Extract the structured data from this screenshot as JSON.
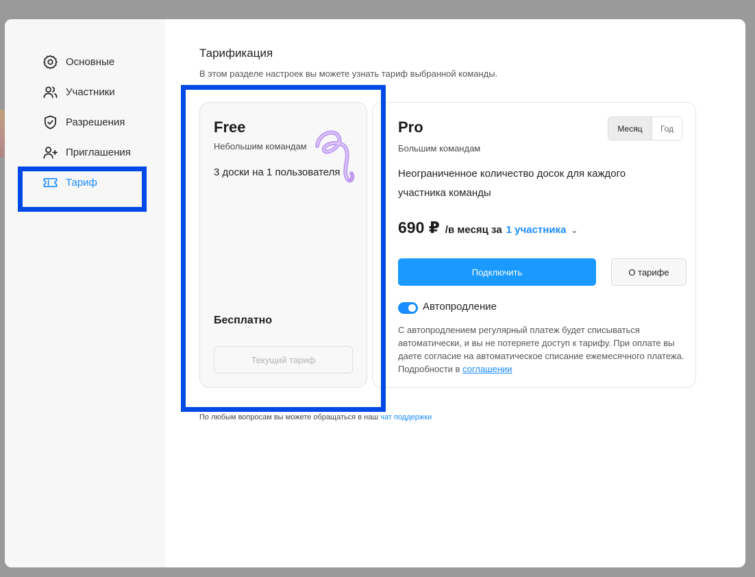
{
  "sidebar": {
    "items": [
      {
        "label": "Основные",
        "icon": "gear-icon"
      },
      {
        "label": "Участники",
        "icon": "users-icon"
      },
      {
        "label": "Разрешения",
        "icon": "shield-check-icon"
      },
      {
        "label": "Приглашения",
        "icon": "user-plus-icon"
      },
      {
        "label": "Тариф",
        "icon": "ticket-icon",
        "active": true
      }
    ]
  },
  "main": {
    "title": "Тарификация",
    "subtitle": "В этом разделе настроек вы можете узнать тариф выбранной команды."
  },
  "plans": {
    "free": {
      "name": "Free",
      "subtitle": "Небольшим командам",
      "description": "3 доски на 1 пользователя",
      "price": "Бесплатно",
      "current_button": "Текущий тариф"
    },
    "pro": {
      "name": "Pro",
      "subtitle": "Большим командам",
      "description": "Неограниченное количество досок для каждого участника команды",
      "price": "690 ₽",
      "price_period": "/в месяц за",
      "members": "1 участника",
      "connect_button": "Подключить",
      "about_button": "О тарифе",
      "period_toggle": {
        "month": "Месяц",
        "year": "Год",
        "selected": "Месяц"
      },
      "autorenew_label": "Автопродление",
      "autorenew_enabled": true,
      "autorenew_note": "С автопродлением регулярный платеж будет списываться автоматически, и вы не потеряете доступ к тарифу. При оплате вы даете согласие на автоматическое списание ежемесячного платежа. Подробности в",
      "autorenew_link": "соглашении"
    }
  },
  "footer": {
    "text": "По любым вопросам вы можете обращаться в наш",
    "link": "чат поддержки"
  },
  "colors": {
    "accent": "#1a8cff",
    "highlight": "#0049e6",
    "overlay": "#9a9a9a",
    "sidebar_bg": "#f7f7f7"
  }
}
